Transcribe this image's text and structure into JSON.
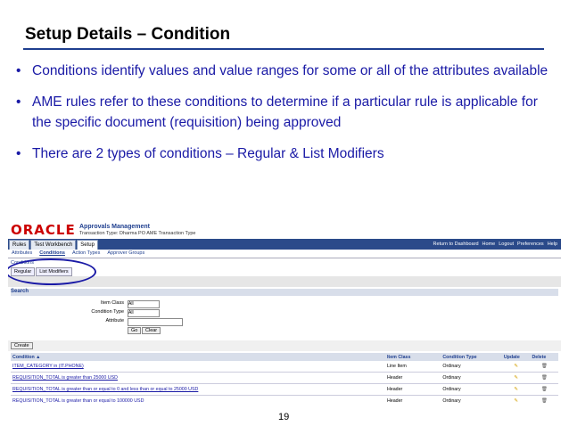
{
  "slide": {
    "title": "Setup Details – Condition",
    "bullets": [
      "Conditions identify values and value ranges for some or all of the attributes available",
      "AME rules refer to these conditions to determine if a particular rule is applicable for the specific document (requisition) being approved",
      "There are 2 types of conditions – Regular & List Modifiers"
    ],
    "page_number": "19"
  },
  "app": {
    "logo": "ORACLE",
    "name": "Approvals Management",
    "transaction": "Transaction Type: Dharma PO AME Transaction Type",
    "tabs": [
      "Rules",
      "Test Workbench",
      "Setup"
    ],
    "global_links": [
      "Return to Dashboard",
      "Home",
      "Logout",
      "Preferences",
      "Help"
    ],
    "subtabs": [
      "Attributes",
      "Conditions",
      "Action Types",
      "Approver Groups"
    ],
    "breadcrumb": "Conditions",
    "condition_tabs": [
      "Regular",
      "List Modifiers"
    ],
    "search": {
      "header": "Search",
      "item_class_label": "Item Class",
      "item_class_value": "All",
      "condition_type_label": "Condition Type",
      "condition_type_value": "All",
      "attribute_label": "Attribute",
      "go_label": "Go",
      "clear_label": "Clear"
    },
    "create_label": "Create",
    "table": {
      "headers": [
        "Condition ▲",
        "Item Class",
        "Condition Type",
        "Update",
        "Delete"
      ],
      "rows": [
        [
          "ITEM_CATEGORY in (IT.PHONE)",
          "Line Item",
          "Ordinary"
        ],
        [
          "REQUISITION_TOTAL is greater than 25000 USD",
          "Header",
          "Ordinary"
        ],
        [
          "REQUISITION_TOTAL is greater than or equal to 0 and less than or equal to 25000 USD",
          "Header",
          "Ordinary"
        ],
        [
          "REQUISITION_TOTAL is greater than or equal to 100000 USD",
          "Header",
          "Ordinary"
        ]
      ]
    }
  }
}
